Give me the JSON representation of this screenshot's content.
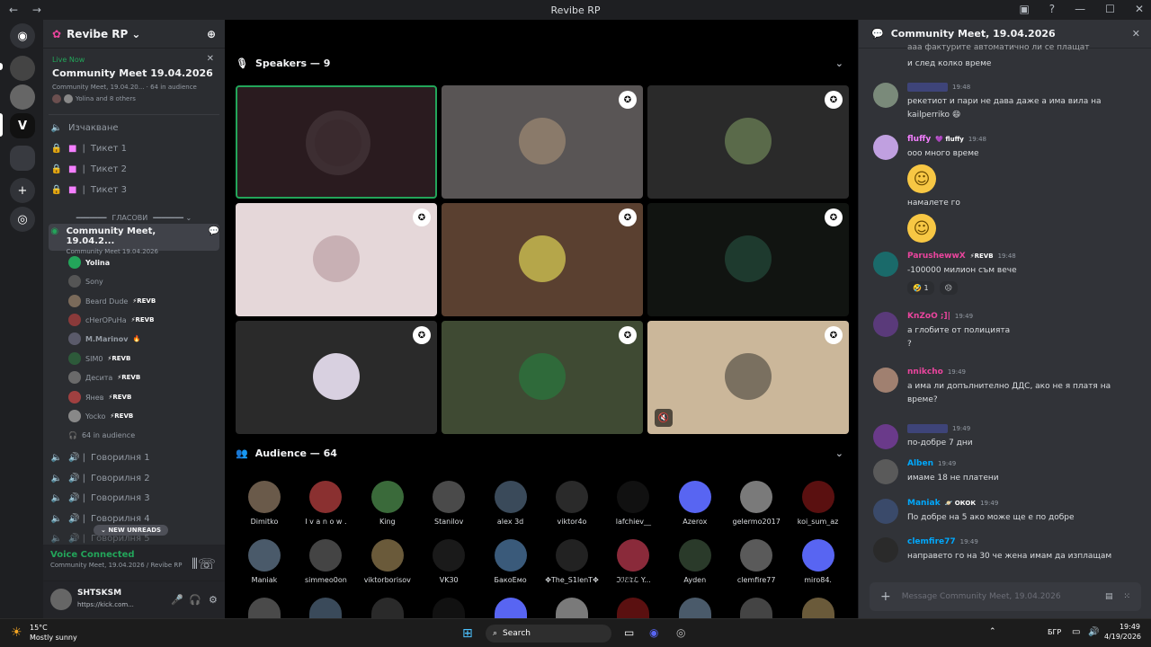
{
  "window": {
    "title": "Revibe RP"
  },
  "guild_rail": {
    "items": [
      "discord-home",
      "server-1",
      "server-2",
      "revibe-rp",
      "folder",
      "add-server",
      "discover"
    ]
  },
  "server": {
    "name": "Revibe RP"
  },
  "live": {
    "tag": "Live Now",
    "title": "Community Meet 19.04.2026",
    "sub": "Community Meet, 19.04.20... · 64 in audience",
    "users": "Yolina and 8 others"
  },
  "channels": {
    "waiting": "Изчакване",
    "tickets": [
      "Тикет 1",
      "Тикет 2",
      "Тикет 3"
    ],
    "category": "ГЛАСОВИ",
    "stage_name": "Community Meet, 19.04.2...",
    "stage_sub": "Community Meet 19.04.2026",
    "members": [
      {
        "name": "Yolina",
        "badge": ""
      },
      {
        "name": "Sony",
        "badge": ""
      },
      {
        "name": "Beard Dude",
        "badge": "⚡REVB"
      },
      {
        "name": "cHerOPuHa",
        "badge": "⚡REVB"
      },
      {
        "name": "M.Marinov",
        "badge": "🔥"
      },
      {
        "name": "SIM0",
        "badge": "⚡REVB"
      },
      {
        "name": "Десита",
        "badge": "⚡REVB"
      },
      {
        "name": "Янев",
        "badge": "⚡REVB"
      },
      {
        "name": "Yocko",
        "badge": "⚡REVB"
      }
    ],
    "audience_count": "64 in audience",
    "talk_rooms": [
      "Говорилня 1",
      "Говорилня 2",
      "Говорилня 3",
      "Говорилня 4",
      "Говорилня 5"
    ],
    "new_unreads": "NEW UNREADS"
  },
  "voice": {
    "status": "Voice Connected",
    "location": "Community Meet, 19.04.2026 / Revibe RP"
  },
  "user": {
    "name": "SHTSKSM",
    "status": "https://kick.com..."
  },
  "stage": {
    "speakers_label": "Speakers — 9",
    "audience_label": "Audience — 64",
    "audience": [
      "Dimitko",
      "I v a n o w .",
      "King",
      "Stanilov",
      "alex 3d",
      "viktor4o",
      "lafchiev__",
      "Azerox",
      "gelermo2017",
      "koi_sum_az",
      "Maniak",
      "simmeo0on",
      "viktorborisov",
      "VK30",
      "БакоЕмо",
      "✥The_S1lenT✥",
      "ℑℐℰ𝔗ℒ Y...",
      "Ayden",
      "clemfire77",
      "miro84."
    ]
  },
  "chat": {
    "title": "Community Meet, 19.04.2026",
    "top_lines": [
      "ааа фактурите автоматично ли се плащат",
      "и след колко време"
    ],
    "messages": [
      {
        "author": "",
        "tag": "",
        "time": "19:48",
        "color": "#5865f2",
        "lines": [
          "рекетиот и пари не дава даже а има вила на kailperriko 😄"
        ]
      },
      {
        "author": "fluffy",
        "tag": "💜 fluffy",
        "time": "19:48",
        "color": "#f47fff",
        "lines": [
          "ооо много време"
        ],
        "emoji_after": true,
        "lines2": [
          "намалете го"
        ],
        "emoji_after2": true
      },
      {
        "author": "ParushewwX",
        "tag": "⚡REVB",
        "time": "19:48",
        "color": "#eb459e",
        "lines": [
          "-100000 милион съм вече"
        ],
        "reactions": [
          "🤣 1",
          "☹"
        ]
      },
      {
        "author": "KnZoO ;]|",
        "tag": "",
        "time": "19:49",
        "color": "#eb459e",
        "lines": [
          "а глобите от полицията",
          "?"
        ]
      },
      {
        "author": "nnikcho",
        "tag": "",
        "time": "19:49",
        "color": "#eb459e",
        "lines": [
          "а има ли допълнително ДДС, ако не я платя на",
          "време?"
        ]
      },
      {
        "author": "",
        "tag": "",
        "time": "19:49",
        "color": "#5865f2",
        "lines": [
          "по-добре 7 дни"
        ]
      },
      {
        "author": "Alben",
        "tag": "",
        "time": "19:49",
        "color": "#00a8fc",
        "lines": [
          "имаме 18 не платени"
        ]
      },
      {
        "author": "Maniak",
        "tag": "🪐 ОКОК",
        "time": "19:49",
        "color": "#00a8fc",
        "lines": [
          "По добре на 5 ако може ще е по добре"
        ]
      },
      {
        "author": "clemfire77",
        "tag": "",
        "time": "19:49",
        "color": "#00a8fc",
        "lines": [
          "направето го на 30 че жена имам да изплащам"
        ]
      }
    ],
    "composer_placeholder": "Message Community Meet, 19.04.2026"
  },
  "taskbar": {
    "weather_temp": "15°C",
    "weather_desc": "Mostly sunny",
    "search": "Search",
    "lang": "БГР",
    "time": "19:49",
    "date": "4/19/2026"
  }
}
